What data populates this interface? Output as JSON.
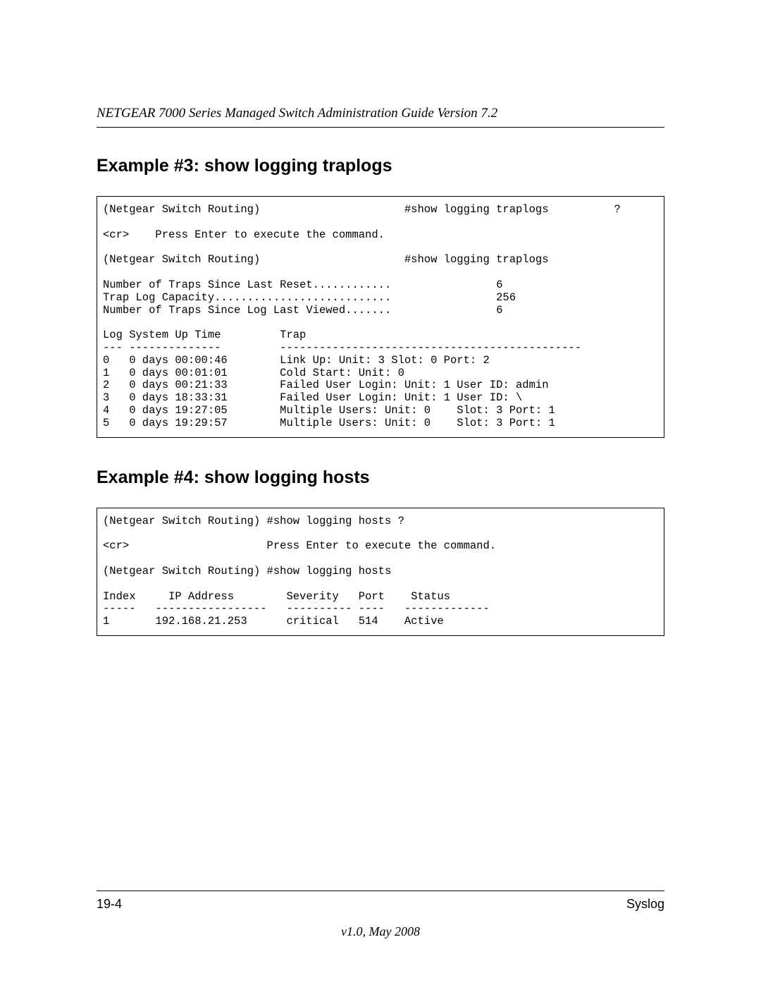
{
  "header": {
    "title": "NETGEAR 7000 Series Managed Switch Administration Guide Version 7.2"
  },
  "example3": {
    "heading": "Example #3: show logging traplogs",
    "code": "(Netgear Switch Routing)                      #show logging traplogs          ?\n\n<cr>    Press Enter to execute the command.\n\n(Netgear Switch Routing)                      #show logging traplogs\n\nNumber of Traps Since Last Reset............                6\nTrap Log Capacity...........................                256\nNumber of Traps Since Log Last Viewed.......                6\n\nLog System Up Time         Trap\n--- --------------         ----------------------------------------------\n0   0 days 00:00:46        Link Up: Unit: 3 Slot: 0 Port: 2\n1   0 days 00:01:01        Cold Start: Unit: 0\n2   0 days 00:21:33        Failed User Login: Unit: 1 User ID: admin\n3   0 days 18:33:31        Failed User Login: Unit: 1 User ID: \\\n4   0 days 19:27:05        Multiple Users: Unit: 0    Slot: 3 Port: 1\n5   0 days 19:29:57        Multiple Users: Unit: 0    Slot: 3 Port: 1"
  },
  "example4": {
    "heading": "Example #4: show logging hosts",
    "code": "(Netgear Switch Routing) #show logging hosts ?\n\n<cr>                     Press Enter to execute the command.\n\n(Netgear Switch Routing) #show logging hosts\n\nIndex     IP Address        Severity   Port    Status\n-----   -----------------   ---------- ----   -------------\n1       192.168.21.253      critical   514    Active"
  },
  "footer": {
    "page": "19-4",
    "section": "Syslog",
    "version": "v1.0, May 2008"
  }
}
